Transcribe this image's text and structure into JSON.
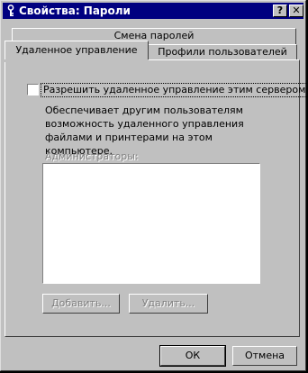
{
  "window": {
    "title": "Свойства: Пароли",
    "help_label": "?",
    "close_label": "✕"
  },
  "tabs": {
    "back": [
      "Смена паролей"
    ],
    "front": [
      "Удаленное управление",
      "Профили пользователей"
    ]
  },
  "remote": {
    "checkbox_label": "Разрешить удаленное управление этим сервером",
    "description": "Обеспечивает другим пользователям возможность удаленного управления файлами и принтерами на этом компьютере.",
    "admins_label": "Администраторы:",
    "add_label": "Добавить...",
    "remove_label": "Удалить..."
  },
  "footer": {
    "ok_label": "ОК",
    "cancel_label": "Отмена"
  }
}
